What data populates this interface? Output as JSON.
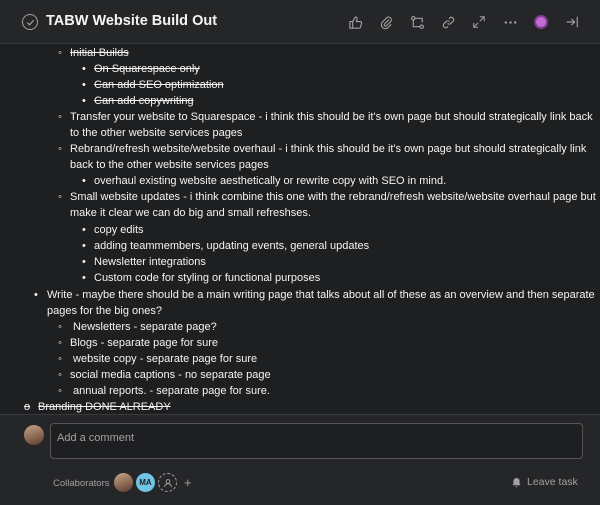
{
  "task": {
    "title": "TABW Website Build Out"
  },
  "lines": [
    {
      "marker": "◦",
      "text": "Initial Builds",
      "strike": true
    },
    {
      "marker": "•",
      "text": "On Squarespace only",
      "strike": true
    },
    {
      "marker": "•",
      "text": "Can add SEO optimization",
      "strike": true
    },
    {
      "marker": "•",
      "text": "Can add copywriting",
      "strike": true
    },
    {
      "marker": "◦",
      "text": "Transfer your website to Squarespace - i think this should be it's own page but should strategically link back"
    },
    {
      "marker": "",
      "text": "to the other website services pages"
    },
    {
      "marker": "◦",
      "text": "Rebrand/refresh website/website overhaul - i think this should be it's own page but should strategically link"
    },
    {
      "marker": "",
      "text": "back to the other website services pages"
    },
    {
      "marker": "•",
      "text": "overhaul existing website aesthetically or rewrite copy with SEO in mind."
    },
    {
      "marker": "◦",
      "text": "Small website updates - i think combine this one with the rebrand/refresh website/website overhaul page but"
    },
    {
      "marker": "",
      "text": "make it clear we can do big and small refreshses."
    },
    {
      "marker": "•",
      "text": "copy edits"
    },
    {
      "marker": "•",
      "text": "adding teammembers, updating events, general updates"
    },
    {
      "marker": "•",
      "text": "Newsletter integrations"
    },
    {
      "marker": "•",
      "text": "Custom code for styling or functional purposes"
    },
    {
      "marker": "•",
      "text": "Write - maybe there should be a main writing page that talks about all of these as an overview and then separate"
    },
    {
      "marker": "",
      "text": "pages for the big ones?"
    },
    {
      "marker": "◦",
      "text": " Newsletters - separate page?"
    },
    {
      "marker": "◦",
      "text": "Blogs - separate page for sure"
    },
    {
      "marker": "◦",
      "text": " website copy - separate page for sure"
    },
    {
      "marker": "◦",
      "text": "social media captions - no separate page"
    },
    {
      "marker": "◦",
      "text": " annual reports. - separate page for sure."
    },
    {
      "marker": "o",
      "text": "Branding DONE ALREADY",
      "strike": true
    }
  ],
  "composer": {
    "placeholder": "Add a comment",
    "collaborators_label": "Collaborators",
    "collaborator_initials": "MA",
    "leave_task": "Leave task"
  },
  "icons": [
    "check-circle-icon",
    "thumbs-up-icon",
    "paperclip-icon",
    "subtask-icon",
    "link-icon",
    "expand-icon",
    "more-icon",
    "avatar-icon",
    "close-panel-icon"
  ]
}
